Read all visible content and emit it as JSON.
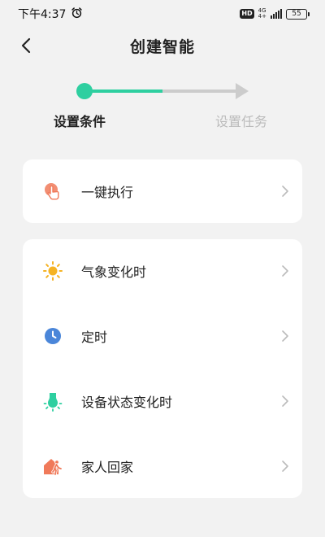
{
  "status_bar": {
    "time": "下午4:37",
    "hd": "HD",
    "network_top": "4G",
    "network_bottom": "4+",
    "battery": "55"
  },
  "header": {
    "title": "创建智能"
  },
  "stepper": {
    "steps": [
      {
        "label": "设置条件",
        "active": true
      },
      {
        "label": "设置任务",
        "active": false
      }
    ],
    "accent_color": "#2ecfa0",
    "inactive_color": "#cccccc"
  },
  "card_manual": {
    "items": [
      {
        "label": "一键执行",
        "icon": "tap-hand-icon",
        "icon_color": "#f07a5a"
      }
    ]
  },
  "card_auto": {
    "items": [
      {
        "label": "气象变化时",
        "icon": "sun-icon",
        "icon_color": "#f5b324"
      },
      {
        "label": "定时",
        "icon": "clock-icon",
        "icon_color": "#4a86d9"
      },
      {
        "label": "设备状态变化时",
        "icon": "bulb-icon",
        "icon_color": "#2ecfa0"
      },
      {
        "label": "家人回家",
        "icon": "home-walker-icon",
        "icon_color": "#f07a5a"
      }
    ]
  }
}
